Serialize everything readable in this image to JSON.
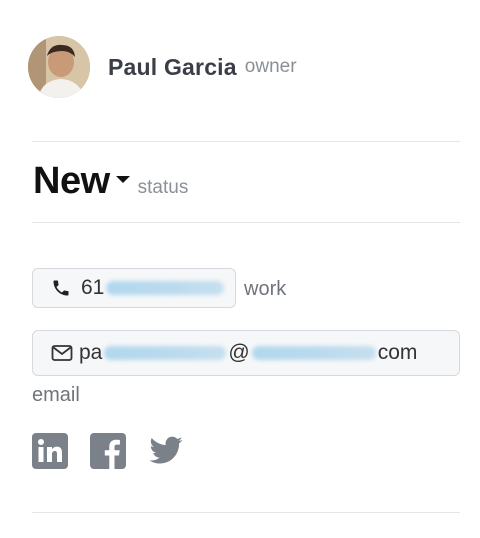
{
  "owner": {
    "name": "Paul Garcia",
    "role_label": "owner",
    "avatar_icon": "avatar-photo"
  },
  "status": {
    "value": "New",
    "label": "status",
    "dropdown_icon": "caret-down-icon"
  },
  "phone": {
    "visible_prefix": "61",
    "label": "work",
    "icon": "phone-icon"
  },
  "email": {
    "visible_start": "pa",
    "visible_at": "@",
    "visible_end": "com",
    "label": "email",
    "icon": "envelope-icon"
  },
  "social": {
    "icons": [
      "linkedin-icon",
      "facebook-icon",
      "twitter-icon"
    ],
    "icon_color": "#7b8188"
  }
}
